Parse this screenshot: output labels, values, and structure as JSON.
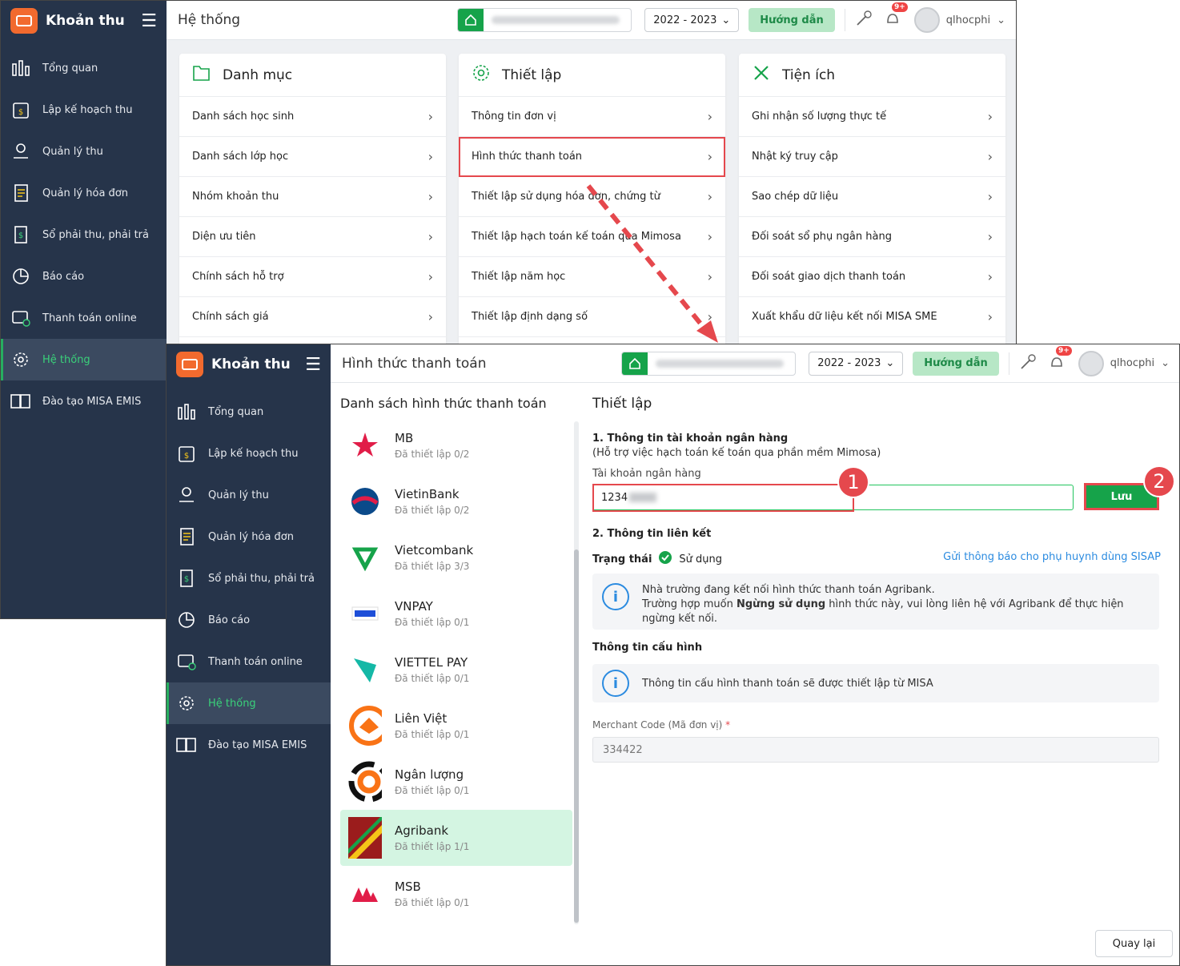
{
  "app": {
    "brand": "Khoản thu"
  },
  "nav": [
    {
      "label": "Tổng quan",
      "icon": "bar-chart-icon"
    },
    {
      "label": "Lập kế hoạch thu",
      "icon": "calendar-dollar-icon"
    },
    {
      "label": "Quản lý thu",
      "icon": "hand-coin-icon"
    },
    {
      "label": "Quản lý hóa đơn",
      "icon": "invoice-icon"
    },
    {
      "label": "Sổ phải thu, phải trả",
      "icon": "ledger-icon"
    },
    {
      "label": "Báo cáo",
      "icon": "pie-chart-icon"
    },
    {
      "label": "Thanh toán online",
      "icon": "online-payment-icon"
    },
    {
      "label": "Hệ thống",
      "icon": "gear-icon"
    },
    {
      "label": "Đào tạo MISA EMIS",
      "icon": "book-icon"
    }
  ],
  "back": {
    "title": "Hệ thống",
    "year": "2022 - 2023",
    "guide": "Hướng dẫn",
    "user": "qlhocphi",
    "badge": "9+",
    "cards": [
      {
        "title": "Danh mục",
        "icon": "folder-icon",
        "rows": [
          "Danh sách học sinh",
          "Danh sách lớp học",
          "Nhóm khoản thu",
          "Diện ưu tiên",
          "Chính sách hỗ trợ",
          "Chính sách giá"
        ]
      },
      {
        "title": "Thiết lập",
        "icon": "settings-icon",
        "rows": [
          "Thông tin đơn vị",
          "Hình thức thanh toán",
          "Thiết lập sử dụng hóa đơn, chứng từ",
          "Thiết lập hạch toán kế toán qua Mimosa",
          "Thiết lập năm học",
          "Thiết lập định dạng số"
        ]
      },
      {
        "title": "Tiện ích",
        "icon": "tools-icon",
        "rows": [
          "Ghi nhận số lượng thực tế",
          "Nhật ký truy cập",
          "Sao chép dữ liệu",
          "Đối soát sổ phụ ngân hàng",
          "Đối soát giao dịch thanh toán",
          "Xuất khẩu dữ liệu kết nối MISA SME"
        ]
      }
    ]
  },
  "front": {
    "title": "Hình thức thanh toán",
    "year": "2022 - 2023",
    "guide": "Hướng dẫn",
    "user": "qlhocphi",
    "badge": "9+",
    "list_title": "Danh sách hình thức thanh toán",
    "banks": [
      {
        "name": "MB",
        "sub": "Đã thiết lập 0/2",
        "color": "#e11d48"
      },
      {
        "name": "VietinBank",
        "sub": "Đã thiết lập 0/2",
        "color": "#0b4a8a"
      },
      {
        "name": "Vietcombank",
        "sub": "Đã thiết lập 3/3",
        "color": "#16a34a"
      },
      {
        "name": "VNPAY",
        "sub": "Đã thiết lập 0/1",
        "color": "#1d4ed8"
      },
      {
        "name": "VIETTEL PAY",
        "sub": "Đã thiết lập 0/1",
        "color": "#14b8a6"
      },
      {
        "name": "Liên Việt",
        "sub": "Đã thiết lập 0/1",
        "color": "#f97316"
      },
      {
        "name": "Ngân lượng",
        "sub": "Đã thiết lập 0/1",
        "color": "#f97316"
      },
      {
        "name": "Agribank",
        "sub": "Đã thiết lập 1/1",
        "color": "#9b1c1c"
      },
      {
        "name": "MSB",
        "sub": "Đã thiết lập 0/1",
        "color": "#e11d48"
      }
    ],
    "setup_title": "Thiết lập",
    "sec1_title": "1. Thông tin tài khoản ngân hàng",
    "sec1_note": "(Hỗ trợ việc hạch toán kế toán qua phần mềm Mimosa)",
    "account_label": "Tài khoản ngân hàng",
    "account_value": "1234",
    "save": "Lưu",
    "sec2_title": "2. Thông tin liên kết",
    "status_label": "Trạng thái",
    "status_value": "Sử dụng",
    "notify_link": "Gửi thông báo cho phụ huynh dùng SISAP",
    "info1_a": "Nhà trường đang kết nối hình thức thanh toán Agribank.",
    "info1_b": "Trường hợp muốn ",
    "info1_bold": "Ngừng sử dụng",
    "info1_c": " hình thức này, vui lòng liên hệ với Agribank để thực hiện ngừng kết nối.",
    "config_title": "Thông tin cấu hình",
    "info2": "Thông tin cấu hình thanh toán sẽ được thiết lập từ MISA",
    "merchant_label": "Merchant Code (Mã đơn vị)",
    "merchant_value": "334422",
    "back_btn": "Quay lại"
  },
  "markers": [
    "1",
    "2"
  ]
}
